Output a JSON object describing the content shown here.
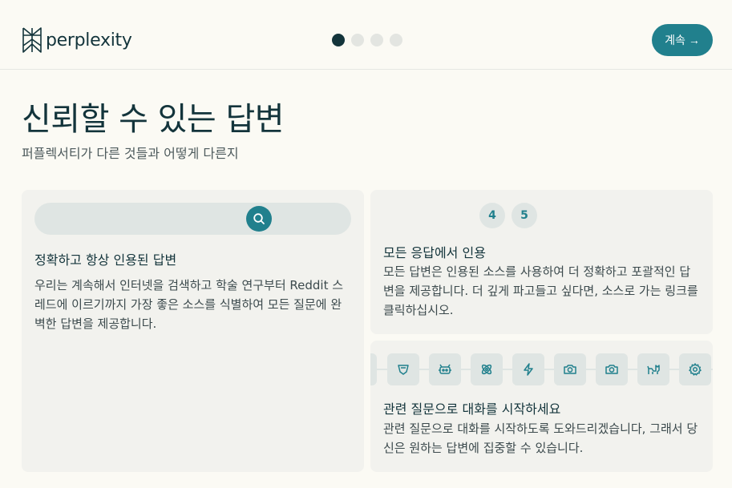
{
  "header": {
    "logo_text": "perplexity",
    "steps": 4,
    "active_step": 1,
    "continue_label": "계속 →"
  },
  "main": {
    "title": "신뢰할 수 있는 답변",
    "subtitle": "퍼플렉서티가 다른 것들과 어떻게 다른지"
  },
  "cards": {
    "accurate": {
      "heading": "정확하고 항상 인용된 답변",
      "body": "우리는 계속해서 인터넷을 검색하고 학술 연구부터 Reddit 스레드에 이르기까지 가장 좋은 소스를 식별하여 모든 질문에 완벽한 답변을 제공합니다."
    },
    "citations": {
      "badges": [
        "4",
        "5"
      ],
      "heading": "모든 응답에서 인용",
      "body": "모든 답변은 인용된 소스를 사용하여 더 정확하고 포괄적인 답변을 제공합니다. 더 깊게 파고들고 싶다면, 소스로 가는 링크를 클릭하십시오."
    },
    "related": {
      "icons": [
        "partial-tile-icon",
        "shield-icon",
        "robot-icon",
        "atom-icon",
        "lightning-icon",
        "camera-icon",
        "camera-icon",
        "animal-icon",
        "gear-icon"
      ],
      "heading": "관련 질문으로 대화를 시작하세요",
      "body": "관련 질문으로 대화를 시작하도록 도와드리겠습니다, 그래서 당신은 원하는 답변에 집중할 수 있습니다."
    }
  },
  "colors": {
    "accent": "#21808d",
    "text_dark": "#13343b",
    "background": "#fbfaf4",
    "card": "#f2f2ee"
  }
}
